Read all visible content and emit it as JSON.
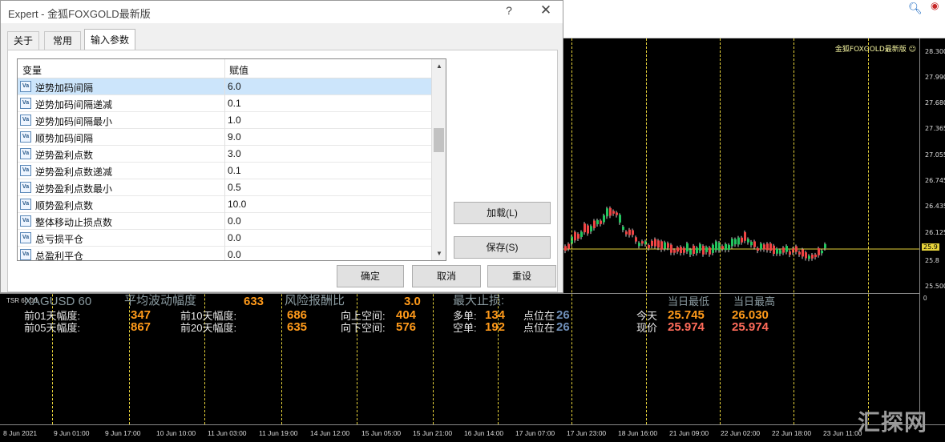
{
  "dialog": {
    "title": "Expert - 金狐FOXGOLD最新版",
    "help_glyph": "?",
    "close_glyph": "✕",
    "tabs": [
      {
        "label": "关于"
      },
      {
        "label": "常用"
      },
      {
        "label": "输入参数"
      }
    ],
    "grid": {
      "col_variable": "变量",
      "col_value": "赋值",
      "rows": [
        {
          "name": "逆势加码间隔",
          "value": "6.0"
        },
        {
          "name": "逆势加码间隔递减",
          "value": "0.1"
        },
        {
          "name": "逆势加码间隔最小",
          "value": "1.0"
        },
        {
          "name": "顺势加码间隔",
          "value": "9.0"
        },
        {
          "name": "逆势盈利点数",
          "value": "3.0"
        },
        {
          "name": "逆势盈利点数递减",
          "value": "0.1"
        },
        {
          "name": "逆势盈利点数最小",
          "value": "0.5"
        },
        {
          "name": "顺势盈利点数",
          "value": "10.0"
        },
        {
          "name": "整体移动止损点数",
          "value": "0.0"
        },
        {
          "name": "总亏损平仓",
          "value": "0.0"
        },
        {
          "name": "总盈利平仓",
          "value": "0.0"
        }
      ],
      "var_icon_text": "Va"
    },
    "buttons": {
      "load": "加载(L)",
      "save": "保存(S)",
      "ok": "确定",
      "cancel": "取消",
      "reset": "重设"
    }
  },
  "chart": {
    "ea_label": "金狐FOXGOLD最新版 ☺",
    "price_ticks": [
      "28.300",
      "27.990",
      "27.680",
      "27.365",
      "27.055",
      "26.745",
      "26.435",
      "26.125",
      "25.9",
      "25.8",
      "25.500"
    ],
    "current_price_line_color": "#e6d23a"
  },
  "indicator": {
    "tsr_label": "TSR 60.00",
    "axis_tick": "0",
    "symbol": "XAGUSD 60",
    "avg_label": "平均波动幅度",
    "avg_value": "633",
    "risk_label": "风险报酬比",
    "risk_value": "3.0",
    "max_stop_label": "最大止损:",
    "d1_label": "前01天幅度:",
    "d1_value": "347",
    "d5_label": "前05天幅度:",
    "d5_value": "867",
    "d10_label": "前10天幅度:",
    "d10_value": "686",
    "d20_label": "前20天幅度:",
    "d20_value": "635",
    "up_label": "向上空间:",
    "up_value": "404",
    "down_label": "向下空间:",
    "down_value": "576",
    "long_label": "多单:",
    "long_value": "134",
    "short_label": "空单:",
    "short_value": "192",
    "point1_label": "点位在",
    "point1_value": "26",
    "point2_label": "点位在",
    "point2_value": "26",
    "today_label": "今天",
    "now_label": "现价",
    "low_label": "当日最低",
    "high_label": "当日最高",
    "today_low": "25.745",
    "today_high": "26.030",
    "now_low": "25.974",
    "now_high": "25.974"
  },
  "time_axis": [
    "8 Jun 2021",
    "9 Jun 01:00",
    "9 Jun 17:00",
    "10 Jun 10:00",
    "11 Jun 03:00",
    "11 Jun 19:00",
    "14 Jun 12:00",
    "15 Jun 05:00",
    "15 Jun 21:00",
    "16 Jun 14:00",
    "17 Jun 07:00",
    "17 Jun 23:00",
    "18 Jun 16:00",
    "21 Jun 09:00",
    "22 Jun 02:00",
    "22 Jun 18:00",
    "23 Jun 11:00"
  ],
  "watermark": "汇探网"
}
